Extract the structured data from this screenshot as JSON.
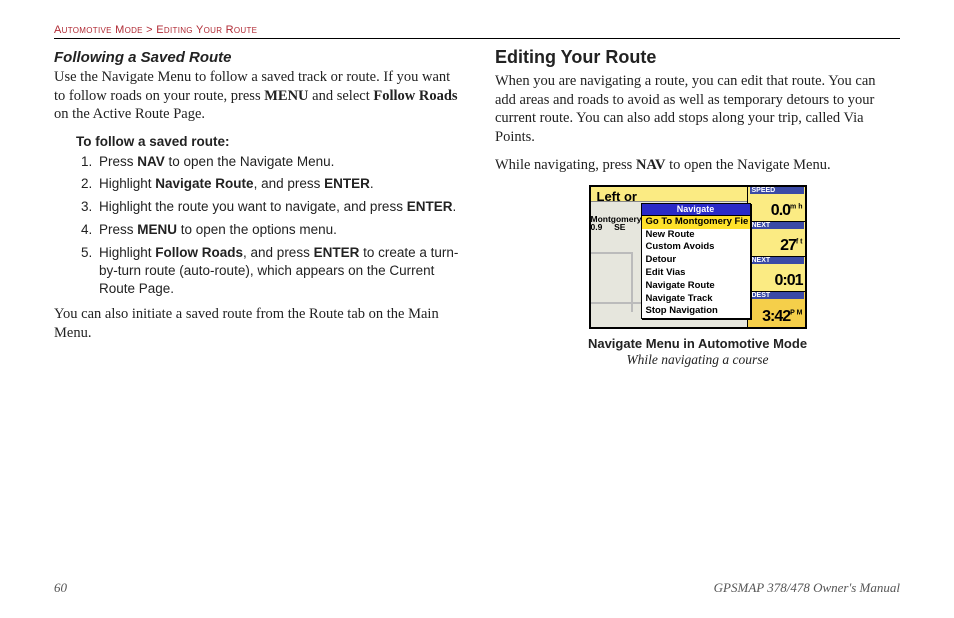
{
  "breadcrumb": {
    "a": "Automotive Mode",
    "sep": ">",
    "b": "Editing Your Route"
  },
  "left": {
    "subheading": "Following a Saved Route",
    "intro_parts": {
      "p1": "Use the Navigate Menu to follow a saved track or route. If you want to follow roads on your route, press ",
      "b1": "MENU",
      "p2": " and select ",
      "b2": "Follow Roads",
      "p3": " on the Active Route Page."
    },
    "task": "To follow a saved route:",
    "steps": [
      {
        "pre": "Press ",
        "b1": "NAV",
        "post": " to open the Navigate Menu."
      },
      {
        "pre": "Highlight ",
        "b1": "Navigate Route",
        "mid": ", and press ",
        "b2": "ENTER",
        "post": "."
      },
      {
        "pre": "Highlight the route you want to navigate, and press ",
        "b1": "ENTER",
        "post": "."
      },
      {
        "pre": "Press ",
        "b1": "MENU",
        "post": " to open the options menu."
      },
      {
        "pre": "Highlight ",
        "b1": "Follow Roads",
        "mid": ", and press ",
        "b2": "ENTER",
        "post": " to create a turn-by-turn route (auto-route), which appears on the Current Route Page."
      }
    ],
    "closing": "You can also initiate a saved route from the Route tab on the Main Menu."
  },
  "right": {
    "heading": "Editing Your Route",
    "p1": "When you are navigating a route, you can edit that route. You can add areas and roads to avoid as well as temporary detours to your current route. You can also add stops along your trip, called Via Points.",
    "p2_parts": {
      "pre": "While navigating, press ",
      "b1": "NAV",
      "post": " to open the Navigate Menu."
    }
  },
  "screenshot": {
    "top_label": "Left or",
    "sm1": "Montgomery F",
    "sm2": "0.9",
    "sm3": "SE",
    "stats": [
      {
        "lbl": "SPEED",
        "val": "0.0",
        "unit": "m h"
      },
      {
        "lbl": "NEXT",
        "val": "27",
        "unit": "f t"
      },
      {
        "lbl": "NEXT",
        "val": "0:01",
        "unit": ""
      },
      {
        "lbl": "DEST",
        "val": "3:42",
        "unit": "P M"
      }
    ],
    "menu": {
      "title": "Navigate",
      "items": [
        {
          "label": "Go To Montgomery Fie",
          "selected": true
        },
        {
          "label": "New Route",
          "selected": false
        },
        {
          "label": "Custom Avoids",
          "selected": false
        },
        {
          "label": "Detour",
          "selected": false
        },
        {
          "label": "Edit Vias",
          "selected": false
        },
        {
          "label": "Navigate Route",
          "selected": false
        },
        {
          "label": "Navigate Track",
          "selected": false
        },
        {
          "label": "Stop Navigation",
          "selected": false
        }
      ]
    },
    "caption1": "Navigate Menu in Automotive Mode",
    "caption2": "While navigating a course"
  },
  "footer": {
    "page": "60",
    "manual": "GPSMAP 378/478 Owner's Manual"
  }
}
